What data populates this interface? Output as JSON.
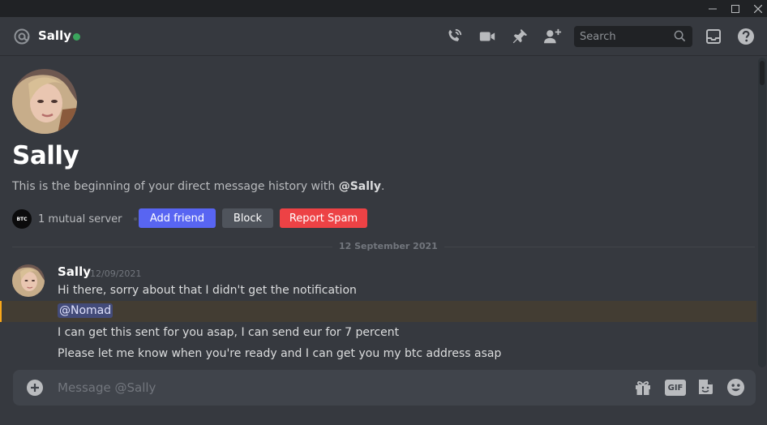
{
  "window_controls": {
    "minimize": "minimize-icon",
    "maximize": "maximize-icon",
    "close": "close-icon"
  },
  "header": {
    "channel_icon": "at-icon",
    "name": "Sally",
    "status": "online",
    "status_color": "#3ba55d",
    "actions": [
      "voice-call-icon",
      "video-call-icon",
      "pin-icon",
      "add-friend-icon"
    ],
    "search_placeholder": "Search",
    "inbox_icon": "inbox-icon",
    "help_icon": "help-icon"
  },
  "profile": {
    "name": "Sally",
    "intro_prefix": "This is the beginning of your direct message history with ",
    "intro_handle": "@Sally",
    "intro_suffix": ".",
    "mutual_server_badge": "BTC",
    "mutual_servers": "1 mutual server",
    "add_friend": "Add friend",
    "block": "Block",
    "report_spam": "Report Spam"
  },
  "colors": {
    "blurple": "#5865f2",
    "grey_button": "#4f545c",
    "danger": "#ed4245",
    "mention_highlight": "#faa81a"
  },
  "date_divider": "12 September 2021",
  "message": {
    "author": "Sally",
    "timestamp": "12/09/2021",
    "lines": [
      "Hi there, sorry about that I didn't get the notification",
      "@Nomad",
      "I can get this sent for you asap, I can send eur for 7 percent",
      "Please let me know when you're ready and I can get you my btc address asap"
    ]
  },
  "composer": {
    "add_icon": "plus-circle-icon",
    "placeholder": "Message @Sally",
    "tools": [
      "gift-icon",
      "gif-icon",
      "sticker-icon",
      "emoji-icon"
    ],
    "gif_label": "GIF"
  }
}
